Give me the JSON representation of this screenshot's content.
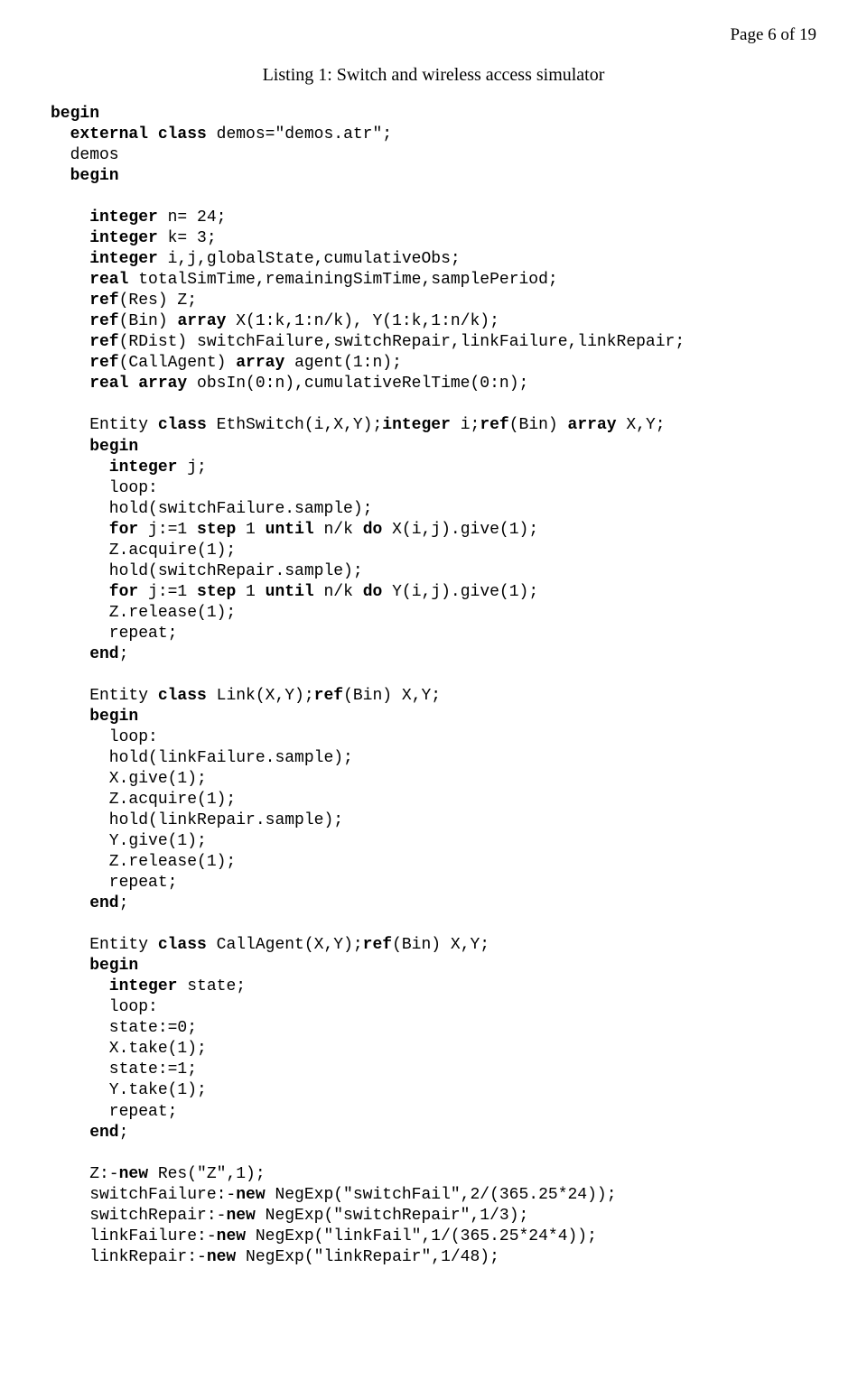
{
  "header": {
    "page_label": "Page 6 of 19"
  },
  "listing": {
    "title": "Listing 1: Switch and wireless access simulator"
  },
  "code": {
    "l01a": "begin",
    "l02": "  external",
    "l02b": " class",
    "l02c": " demos=\"demos.atr\";",
    "l03": "  demos",
    "l04": "  begin",
    "l05": "",
    "l06": "    integer",
    "l06b": " n= 24;",
    "l07": "    integer",
    "l07b": " k= 3;",
    "l08": "    integer",
    "l08b": " i,j,globalState,cumulativeObs;",
    "l09": "    real",
    "l09b": " totalSimTime,remainingSimTime,samplePeriod;",
    "l10": "    ref",
    "l10b": "(Res) Z;",
    "l11": "    ref",
    "l11b": "(Bin)",
    "l11c": " array",
    "l11d": " X(1:k,1:n/k), Y(1:k,1:n/k);",
    "l12": "    ref",
    "l12b": "(RDist) switchFailure,switchRepair,linkFailure,linkRepair;",
    "l13": "    ref",
    "l13b": "(CallAgent)",
    "l13c": " array",
    "l13d": " agent(1:n);",
    "l14": "    real array",
    "l14b": " obsIn(0:n),cumulativeRelTime(0:n);",
    "l15": "",
    "l16a": "    Entity",
    "l16b": " class",
    "l16c": " EthSwitch(i,X,Y);",
    "l16d": "integer",
    "l16e": " i;",
    "l16f": "ref",
    "l16g": "(Bin)",
    "l16h": " array",
    "l16i": " X,Y;",
    "l17": "    begin",
    "l18": "      integer",
    "l18b": " j;",
    "l19": "      loop:",
    "l20": "      hold(switchFailure.sample);",
    "l21": "      for",
    "l21b": " j:=1",
    "l21c": " step",
    "l21d": " 1",
    "l21e": " until",
    "l21f": " n/k",
    "l21g": " do",
    "l21h": " X(i,j).give(1);",
    "l22": "      Z.acquire(1);",
    "l23": "      hold(switchRepair.sample);",
    "l24": "      for",
    "l24b": " j:=1",
    "l24c": " step",
    "l24d": " 1",
    "l24e": " until",
    "l24f": " n/k",
    "l24g": " do",
    "l24h": " Y(i,j).give(1);",
    "l25": "      Z.release(1);",
    "l26": "      repeat;",
    "l27": "    end",
    "l27b": ";",
    "l28": "",
    "l29a": "    Entity",
    "l29b": " class",
    "l29c": " Link(X,Y);",
    "l29d": "ref",
    "l29e": "(Bin) X,Y;",
    "l30": "    begin",
    "l31": "      loop:",
    "l32": "      hold(linkFailure.sample);",
    "l33": "      X.give(1);",
    "l34": "      Z.acquire(1);",
    "l35": "      hold(linkRepair.sample);",
    "l36": "      Y.give(1);",
    "l37": "      Z.release(1);",
    "l38": "      repeat;",
    "l39": "    end",
    "l39b": ";",
    "l40": "",
    "l41a": "    Entity",
    "l41b": " class",
    "l41c": " CallAgent(X,Y);",
    "l41d": "ref",
    "l41e": "(Bin) X,Y;",
    "l42": "    begin",
    "l43": "      integer",
    "l43b": " state;",
    "l44": "      loop:",
    "l45": "      state:=0;",
    "l46": "      X.take(1);",
    "l47": "      state:=1;",
    "l48": "      Y.take(1);",
    "l49": "      repeat;",
    "l50": "    end",
    "l50b": ";",
    "l51": "",
    "l52": "    Z:-",
    "l52b": "new",
    "l52c": " Res(\"Z\",1);",
    "l53": "    switchFailure:-",
    "l53b": "new",
    "l53c": " NegExp(\"switchFail\",2/(365.25*24));",
    "l54": "    switchRepair:-",
    "l54b": "new",
    "l54c": " NegExp(\"switchRepair\",1/3);",
    "l55": "    linkFailure:-",
    "l55b": "new",
    "l55c": " NegExp(\"linkFail\",1/(365.25*24*4));",
    "l56": "    linkRepair:-",
    "l56b": "new",
    "l56c": " NegExp(\"linkRepair\",1/48);"
  }
}
